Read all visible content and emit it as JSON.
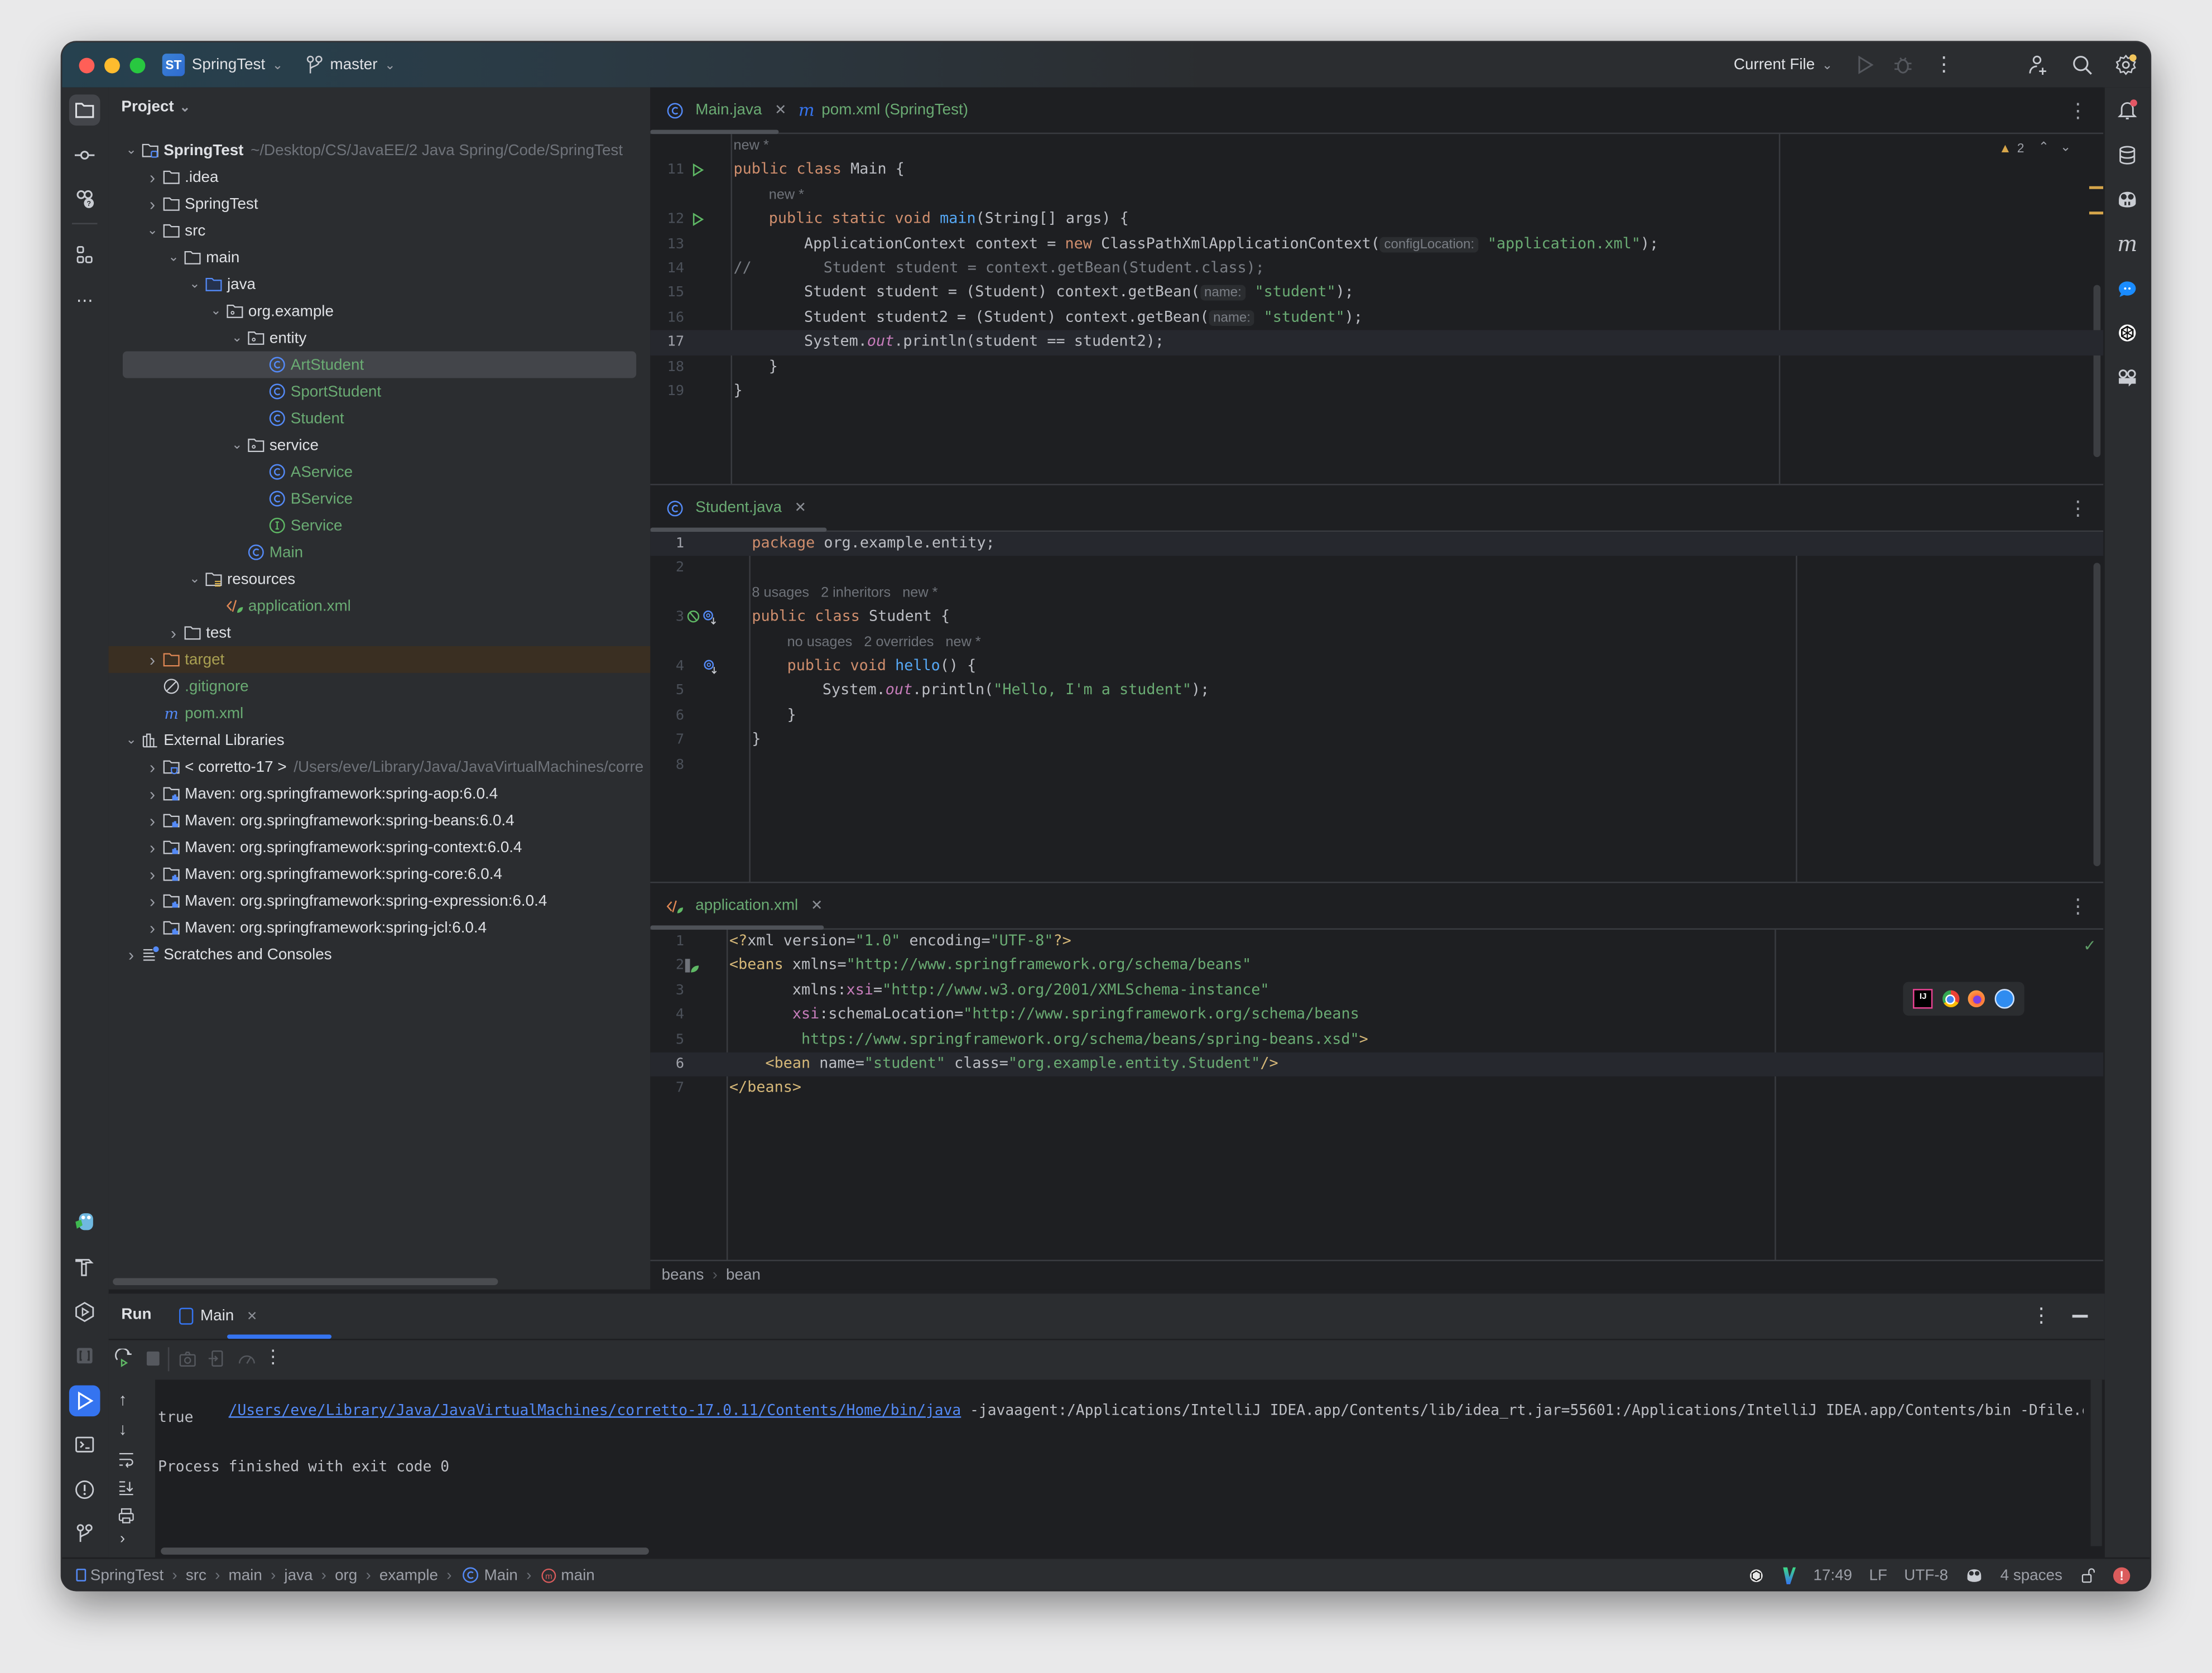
{
  "titlebar": {
    "project_badge": "ST",
    "project_name": "SpringTest",
    "branch": "master",
    "run_config": "Current File"
  },
  "project_panel": {
    "title": "Project",
    "tree": [
      {
        "depth": 0,
        "arrow": "open",
        "icon": "module-folder-icon",
        "label": "SpringTest",
        "bold": true,
        "hint": "~/Desktop/CS/JavaEE/2 Java Spring/Code/SpringTest"
      },
      {
        "depth": 1,
        "arrow": "closed",
        "icon": "folder-icon",
        "label": ".idea"
      },
      {
        "depth": 1,
        "arrow": "closed",
        "icon": "folder-icon",
        "label": "SpringTest"
      },
      {
        "depth": 1,
        "arrow": "open",
        "icon": "folder-icon",
        "label": "src"
      },
      {
        "depth": 2,
        "arrow": "open",
        "icon": "folder-icon",
        "label": "main"
      },
      {
        "depth": 3,
        "arrow": "open",
        "icon": "source-folder-icon",
        "label": "java"
      },
      {
        "depth": 4,
        "arrow": "open",
        "icon": "package-icon",
        "label": "org.example"
      },
      {
        "depth": 5,
        "arrow": "open",
        "icon": "package-icon",
        "label": "entity"
      },
      {
        "depth": 6,
        "arrow": "none",
        "icon": "class-icon",
        "label": "ArtStudent",
        "color": "green",
        "selected": true
      },
      {
        "depth": 6,
        "arrow": "none",
        "icon": "class-icon",
        "label": "SportStudent",
        "color": "green"
      },
      {
        "depth": 6,
        "arrow": "none",
        "icon": "class-icon",
        "label": "Student",
        "color": "green"
      },
      {
        "depth": 5,
        "arrow": "open",
        "icon": "package-icon",
        "label": "service"
      },
      {
        "depth": 6,
        "arrow": "none",
        "icon": "class-icon",
        "label": "AService",
        "color": "green"
      },
      {
        "depth": 6,
        "arrow": "none",
        "icon": "class-icon",
        "label": "BService",
        "color": "green"
      },
      {
        "depth": 6,
        "arrow": "none",
        "icon": "interface-icon",
        "label": "Service",
        "color": "green"
      },
      {
        "depth": 5,
        "arrow": "none",
        "icon": "class-icon",
        "label": "Main",
        "color": "green"
      },
      {
        "depth": 3,
        "arrow": "open",
        "icon": "resources-folder-icon",
        "label": "resources"
      },
      {
        "depth": 4,
        "arrow": "none",
        "icon": "spring-xml-icon",
        "label": "application.xml",
        "color": "green"
      },
      {
        "depth": 2,
        "arrow": "closed",
        "icon": "folder-icon",
        "label": "test"
      },
      {
        "depth": 1,
        "arrow": "closed",
        "icon": "excluded-folder-icon",
        "label": "target",
        "color": "olive",
        "excluded": true
      },
      {
        "depth": 1,
        "arrow": "none",
        "icon": "ignore-file-icon",
        "label": ".gitignore",
        "color": "green"
      },
      {
        "depth": 1,
        "arrow": "none",
        "icon": "maven-icon",
        "label": "pom.xml",
        "color": "green"
      },
      {
        "depth": 0,
        "arrow": "open",
        "icon": "libraries-icon",
        "label": "External Libraries"
      },
      {
        "depth": 1,
        "arrow": "closed",
        "icon": "jdk-icon",
        "label": "< corretto-17 >",
        "hint": "/Users/eve/Library/Java/JavaVirtualMachines/corre"
      },
      {
        "depth": 1,
        "arrow": "closed",
        "icon": "library-icon",
        "label": "Maven: org.springframework:spring-aop:6.0.4"
      },
      {
        "depth": 1,
        "arrow": "closed",
        "icon": "library-icon",
        "label": "Maven: org.springframework:spring-beans:6.0.4"
      },
      {
        "depth": 1,
        "arrow": "closed",
        "icon": "library-icon",
        "label": "Maven: org.springframework:spring-context:6.0.4"
      },
      {
        "depth": 1,
        "arrow": "closed",
        "icon": "library-icon",
        "label": "Maven: org.springframework:spring-core:6.0.4"
      },
      {
        "depth": 1,
        "arrow": "closed",
        "icon": "library-icon",
        "label": "Maven: org.springframework:spring-expression:6.0.4"
      },
      {
        "depth": 1,
        "arrow": "closed",
        "icon": "library-icon",
        "label": "Maven: org.springframework:spring-jcl:6.0.4"
      },
      {
        "depth": 0,
        "arrow": "closed",
        "icon": "scratches-icon",
        "label": "Scratches and Consoles"
      }
    ]
  },
  "editors": {
    "main": {
      "tabs": [
        {
          "label": "Main.java",
          "icon": "class-icon",
          "closable": true,
          "active": true
        },
        {
          "label": "pom.xml (SpringTest)",
          "icon": "maven-icon",
          "closable": false,
          "italic": true
        }
      ],
      "warnings_count": "2",
      "lines": [
        {
          "ln": "",
          "indent": 0,
          "html_hint": "new *"
        },
        {
          "ln": "11",
          "gutter": "run",
          "indent": 0,
          "tokens": [
            [
              "kw",
              "public class "
            ],
            [
              "",
              "Main {"
            ]
          ]
        },
        {
          "ln": "",
          "indent": 1,
          "html_hint": "new *"
        },
        {
          "ln": "12",
          "gutter": "run",
          "indent": 1,
          "tokens": [
            [
              "kw",
              "public static void "
            ],
            [
              "fn",
              "main"
            ],
            [
              "",
              "(String[] args) {"
            ]
          ]
        },
        {
          "ln": "13",
          "indent": 2,
          "tokens": [
            [
              "",
              "ApplicationContext context = "
            ],
            [
              "kw",
              "new "
            ],
            [
              "",
              "ClassPathXmlApplicationContext("
            ],
            [
              "inlay",
              "configLocation:"
            ],
            [
              "str",
              " \"application.xml\""
            ],
            [
              "",
              ");"
            ]
          ]
        },
        {
          "ln": "14",
          "indent": 0,
          "tokens": [
            [
              "cmt",
              "//        Student student = context.getBean(Student.class);"
            ]
          ]
        },
        {
          "ln": "15",
          "indent": 2,
          "tokens": [
            [
              "",
              "Student student = (Student) context.getBean("
            ],
            [
              "inlay",
              "name:"
            ],
            [
              "str",
              " \"student\""
            ],
            [
              "",
              ");"
            ]
          ]
        },
        {
          "ln": "16",
          "indent": 2,
          "tokens": [
            [
              "",
              "Student student2 = (Student) context.getBean("
            ],
            [
              "inlay",
              "name:"
            ],
            [
              "str",
              " \"student\""
            ],
            [
              "",
              ");"
            ]
          ]
        },
        {
          "ln": "17",
          "indent": 2,
          "current": true,
          "tokens": [
            [
              "",
              "System."
            ],
            [
              "stat",
              "out"
            ],
            [
              "",
              ".println(student == student2);"
            ]
          ]
        },
        {
          "ln": "18",
          "indent": 1,
          "tokens": [
            [
              "",
              "}"
            ]
          ]
        },
        {
          "ln": "19",
          "indent": 0,
          "tokens": [
            [
              "",
              "}"
            ]
          ]
        }
      ]
    },
    "student": {
      "tabs": [
        {
          "label": "Student.java",
          "icon": "class-icon",
          "closable": true,
          "active": true
        }
      ],
      "lines": [
        {
          "ln": "1",
          "indent": 0,
          "current": true,
          "tokens": [
            [
              "kw",
              "package "
            ],
            [
              "",
              "org.example.entity;"
            ]
          ]
        },
        {
          "ln": "2",
          "indent": 0,
          "tokens": []
        },
        {
          "ln": "",
          "indent": 0,
          "html_hint": "8 usages   2 inheritors   new *"
        },
        {
          "ln": "3",
          "gutter": "impl",
          "indent": 0,
          "tokens": [
            [
              "kw",
              "public class "
            ],
            [
              "",
              "Student {"
            ]
          ]
        },
        {
          "ln": "",
          "indent": 1,
          "html_hint": "no usages   2 overrides   new *"
        },
        {
          "ln": "4",
          "gutter": "override",
          "indent": 1,
          "tokens": [
            [
              "kw",
              "public void "
            ],
            [
              "fn",
              "hello"
            ],
            [
              "",
              "() {"
            ]
          ]
        },
        {
          "ln": "5",
          "indent": 2,
          "tokens": [
            [
              "",
              "System."
            ],
            [
              "stat",
              "out"
            ],
            [
              "",
              ".println("
            ],
            [
              "str",
              "\"Hello, I'm a student\""
            ],
            [
              "",
              ");"
            ]
          ]
        },
        {
          "ln": "6",
          "indent": 1,
          "tokens": [
            [
              "",
              "}"
            ]
          ]
        },
        {
          "ln": "7",
          "indent": 0,
          "tokens": [
            [
              "",
              "}"
            ]
          ]
        },
        {
          "ln": "8",
          "indent": 0,
          "tokens": []
        }
      ]
    },
    "xml": {
      "tabs": [
        {
          "label": "application.xml",
          "icon": "spring-xml-icon",
          "closable": true,
          "active": true
        }
      ],
      "lines": [
        {
          "ln": "1",
          "indent": 0,
          "tokens": [
            [
              "tag",
              "<?"
            ],
            [
              "",
              "xml version="
            ],
            [
              "str",
              "\"1.0\""
            ],
            [
              "",
              " encoding="
            ],
            [
              "str",
              "\"UTF-8\""
            ],
            [
              "tag",
              "?>"
            ]
          ]
        },
        {
          "ln": "2",
          "gutter": "spring",
          "indent": 0,
          "tokens": [
            [
              "tag",
              "<beans "
            ],
            [
              "",
              "xmlns="
            ],
            [
              "str",
              "\"http://www.springframework.org/schema/beans\""
            ]
          ]
        },
        {
          "ln": "3",
          "indent": 0,
          "tokens": [
            [
              "",
              "       xmlns:"
            ],
            [
              "ns",
              "xsi"
            ],
            [
              "",
              "="
            ],
            [
              "str",
              "\"http://www.w3.org/2001/XMLSchema-instance\""
            ]
          ]
        },
        {
          "ln": "4",
          "indent": 0,
          "tokens": [
            [
              "",
              "       "
            ],
            [
              "ns",
              "xsi"
            ],
            [
              "",
              ":schemaLocation="
            ],
            [
              "str",
              "\"http://www.springframework.org/schema/beans"
            ]
          ]
        },
        {
          "ln": "5",
          "indent": 0,
          "tokens": [
            [
              "str",
              "        https://www.springframework.org/schema/beans/spring-beans.xsd\""
            ],
            [
              "tag",
              ">"
            ]
          ]
        },
        {
          "ln": "6",
          "indent": 0,
          "current": true,
          "tokens": [
            [
              "tag",
              "    <bean "
            ],
            [
              "",
              "name="
            ],
            [
              "str",
              "\"student\""
            ],
            [
              "",
              " class="
            ],
            [
              "str",
              "\"org.example.entity.Student\""
            ],
            [
              "tag",
              "/>"
            ]
          ]
        },
        {
          "ln": "7",
          "indent": 0,
          "tokens": [
            [
              "tag",
              "</beans>"
            ]
          ]
        }
      ],
      "breadcrumb": [
        "beans",
        "bean"
      ]
    }
  },
  "browser_popup": [
    "intellij-icon",
    "chrome-icon",
    "firefox-icon",
    "safari-icon"
  ],
  "run_panel": {
    "title": "Run",
    "tab": "Main",
    "console": {
      "java_path": "/Users/eve/Library/Java/JavaVirtualMachines/corretto-17.0.11/Contents/Home/bin/java",
      "args": " -javaagent:/Applications/IntelliJ IDEA.app/Contents/lib/idea_rt.jar=55601:/Applications/IntelliJ IDEA.app/Contents/bin -Dfile.encoding=UTF",
      "output": "true",
      "exit": "Process finished with exit code 0"
    }
  },
  "status_bar": {
    "breadcrumb": [
      "SpringTest",
      "src",
      "main",
      "java",
      "org",
      "example",
      "Main",
      "main"
    ],
    "position": "17:49",
    "line_sep": "LF",
    "encoding": "UTF-8",
    "indent": "4 spaces"
  },
  "colors": {
    "accent": "#3574f0",
    "string": "#6aab73",
    "keyword": "#cf8e6d",
    "function": "#56a8f5",
    "warning": "#d6a54a",
    "error": "#db5c5c"
  }
}
